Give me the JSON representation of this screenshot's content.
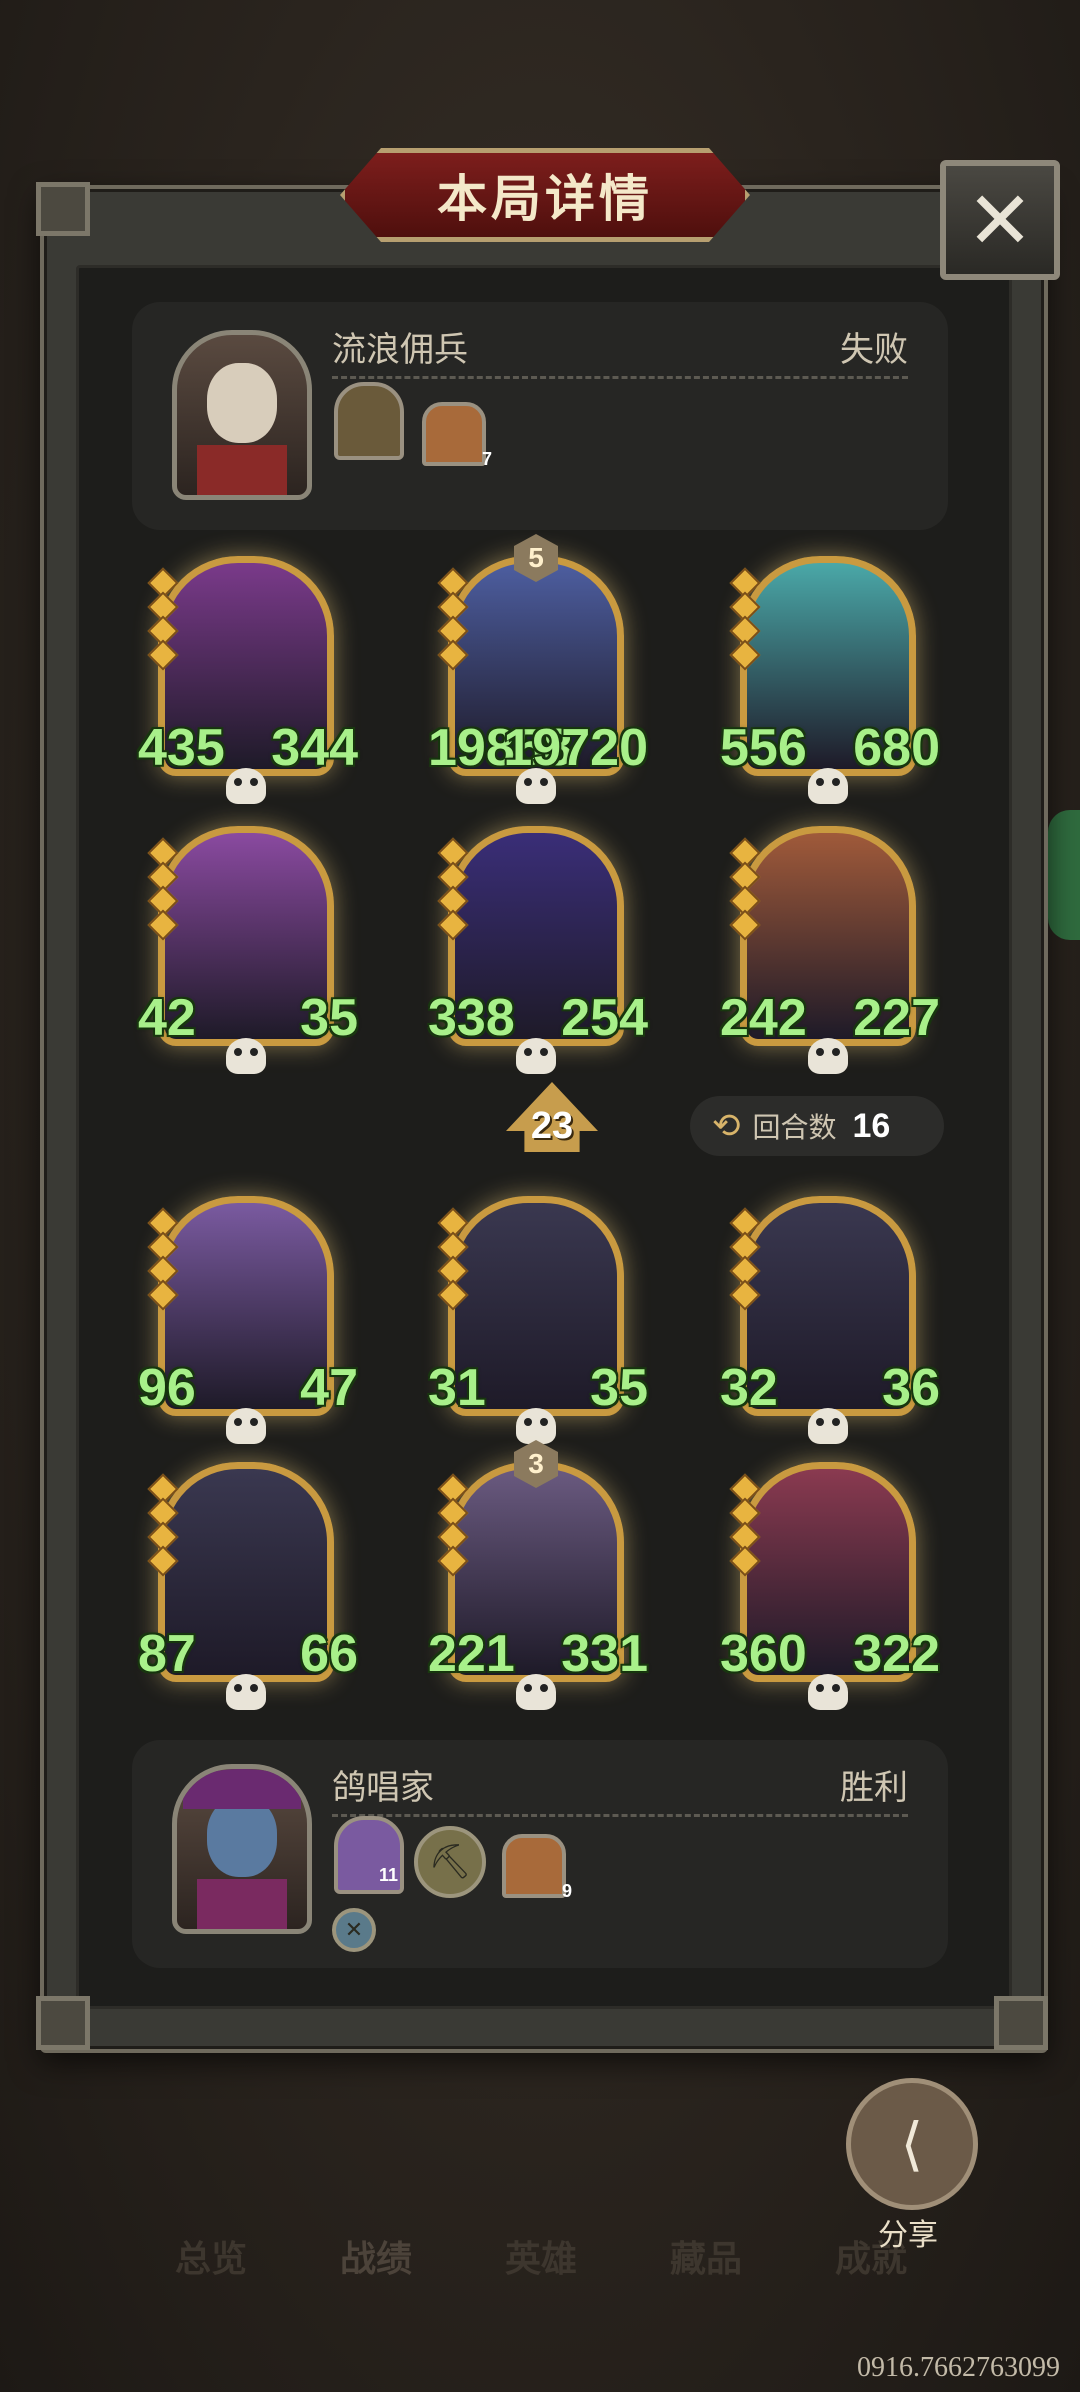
{
  "title": "本局详情",
  "close_label": "✕",
  "opponent": {
    "name": "流浪佣兵",
    "result": "失败",
    "chips": [
      {
        "num": ""
      },
      {
        "num": "7"
      }
    ]
  },
  "opponent_heroes": [
    {
      "atk": "435",
      "hp": "344",
      "tier": "",
      "color": "#7a3a8a"
    },
    {
      "atk": "19858",
      "hp": "19720",
      "tier": "5",
      "color": "#4d5ea0"
    },
    {
      "atk": "556",
      "hp": "680",
      "tier": "",
      "color": "#4aa8a8"
    },
    {
      "atk": "42",
      "hp": "35",
      "tier": "",
      "color": "#8a4aa0"
    },
    {
      "atk": "338",
      "hp": "254",
      "tier": "",
      "color": "#3a2e78"
    },
    {
      "atk": "242",
      "hp": "227",
      "tier": "",
      "color": "#a05a3a"
    }
  ],
  "tavern_level": "23",
  "turns": {
    "label": "回合数",
    "value": "16"
  },
  "player_heroes": [
    {
      "atk": "96",
      "hp": "47",
      "tier": "",
      "color": "#7a5aa0"
    },
    {
      "atk": "31",
      "hp": "35",
      "tier": "",
      "color": "#3a3850"
    },
    {
      "atk": "32",
      "hp": "36",
      "tier": "",
      "color": "#3a3850"
    },
    {
      "atk": "87",
      "hp": "66",
      "tier": "",
      "color": "#3a3850"
    },
    {
      "atk": "221",
      "hp": "331",
      "tier": "3",
      "color": "#6a5a80"
    },
    {
      "atk": "360",
      "hp": "322",
      "tier": "",
      "color": "#8a3a50"
    }
  ],
  "player": {
    "name": "鸽唱家",
    "result": "胜利",
    "chips": [
      {
        "num": "11"
      },
      {
        "num": ""
      },
      {
        "num": "9"
      }
    ]
  },
  "share_label": "分享",
  "nav": [
    "总览",
    "战绩",
    "英雄",
    "藏品",
    "成就"
  ],
  "uid": "0916.7662763099",
  "colors": {
    "stat_green": "#a8f08a",
    "card_gold": "#c99a40",
    "banner_red": "#7d1e1c"
  }
}
